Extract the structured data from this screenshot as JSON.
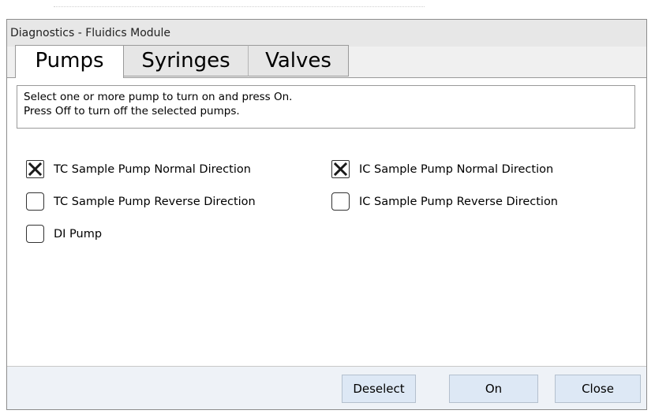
{
  "window": {
    "title": "Diagnostics - Fluidics Module"
  },
  "tabs": [
    {
      "label": "Pumps",
      "active": true
    },
    {
      "label": "Syringes",
      "active": false
    },
    {
      "label": "Valves",
      "active": false
    }
  ],
  "instructions": {
    "line1": "Select one or more pump to turn on and press On.",
    "line2": "Press Off to turn off the selected pumps."
  },
  "pumps": [
    {
      "label": "TC Sample Pump Normal Direction",
      "checked": true
    },
    {
      "label": "IC Sample Pump Normal Direction",
      "checked": true
    },
    {
      "label": "TC Sample Pump Reverse Direction",
      "checked": false
    },
    {
      "label": "IC Sample Pump Reverse Direction",
      "checked": false
    },
    {
      "label": "DI Pump",
      "checked": false
    }
  ],
  "buttons": {
    "deselect": "Deselect",
    "on": "On",
    "close": "Close"
  },
  "colors": {
    "button_bg": "#dde8f5",
    "footer_bg": "#eef2f7",
    "window_bg": "#f0f0f0"
  },
  "icons": {
    "checked_mark": "x-mark-icon"
  }
}
